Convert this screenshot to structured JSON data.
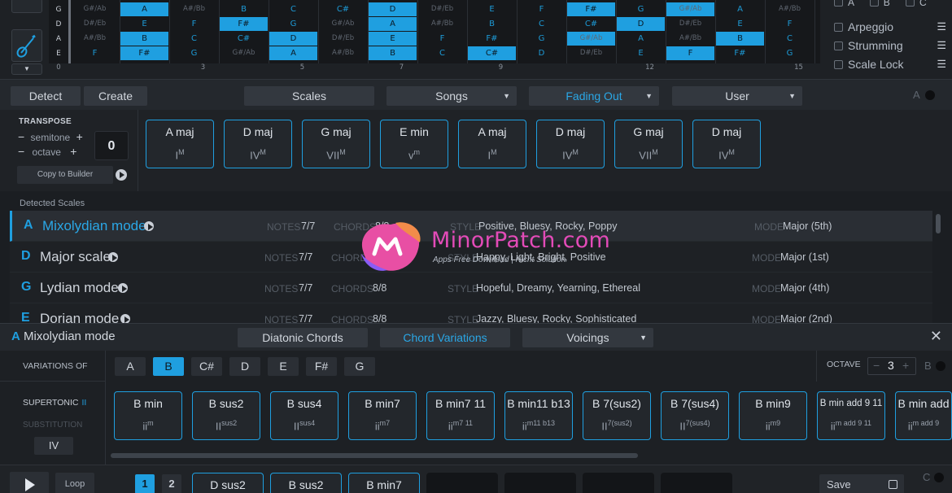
{
  "fretboard": {
    "strings": [
      "G",
      "D",
      "A",
      "E"
    ],
    "fret_numbers": [
      "0",
      "3",
      "5",
      "7",
      "9",
      "12",
      "15"
    ],
    "rows": [
      [
        "G#/Ab",
        "A",
        "A#/Bb",
        "B",
        "C",
        "C#",
        "D",
        "D#/Eb",
        "E",
        "F",
        "F#",
        "G",
        "G#/Ab",
        "A",
        "A#/Bb"
      ],
      [
        "D#/Eb",
        "E",
        "F",
        "F#",
        "G",
        "G#/Ab",
        "A",
        "A#/Bb",
        "B",
        "C",
        "C#",
        "D",
        "D#/Eb",
        "E",
        "F"
      ],
      [
        "A#/Bb",
        "B",
        "C",
        "C#",
        "D",
        "D#/Eb",
        "E",
        "F",
        "F#",
        "G",
        "G#/Ab",
        "A",
        "A#/Bb",
        "B",
        "C"
      ],
      [
        "F",
        "F#",
        "G",
        "G#/Ab",
        "A",
        "A#/Bb",
        "B",
        "C",
        "C#",
        "D",
        "D#/Eb",
        "E",
        "F",
        "F#",
        "G"
      ]
    ]
  },
  "options": {
    "top_labels": [
      "A",
      "B",
      "C"
    ],
    "items": [
      "Arpeggio",
      "Strumming",
      "Scale Lock"
    ]
  },
  "toolbar": {
    "detect": "Detect",
    "create": "Create",
    "scales": "Scales",
    "songs": "Songs",
    "fading_out": "Fading Out",
    "user": "User",
    "right_letter": "A"
  },
  "transpose": {
    "title": "TRANSPOSE",
    "semitone": "semitone",
    "octave": "octave",
    "value": "0",
    "copy_label": "Copy to Builder"
  },
  "progression": [
    {
      "name": "A maj",
      "roman": "I",
      "quality": "M"
    },
    {
      "name": "D maj",
      "roman": "IV",
      "quality": "M"
    },
    {
      "name": "G maj",
      "roman": "VII",
      "quality": "M"
    },
    {
      "name": "E min",
      "roman": "v",
      "quality": "m"
    },
    {
      "name": "A maj",
      "roman": "I",
      "quality": "M"
    },
    {
      "name": "D maj",
      "roman": "IV",
      "quality": "M"
    },
    {
      "name": "G maj",
      "roman": "VII",
      "quality": "M"
    },
    {
      "name": "D maj",
      "roman": "IV",
      "quality": "M"
    }
  ],
  "detected": {
    "title": "Detected Scales",
    "notes_label": "NOTES",
    "chords_label": "CHORDS",
    "style_label": "STYLE",
    "mode_label": "MODE",
    "rows": [
      {
        "key": "A",
        "name": "Mixolydian mode",
        "notes": "7/7",
        "chords": "8/8",
        "style": "Positive, Bluesy, Rocky, Poppy",
        "mode": "Major (5th)"
      },
      {
        "key": "D",
        "name": "Major scale",
        "notes": "7/7",
        "chords": "8/8",
        "style": "Happy, Light, Bright, Positive",
        "mode": "Major (1st)"
      },
      {
        "key": "G",
        "name": "Lydian mode",
        "notes": "7/7",
        "chords": "8/8",
        "style": "Hopeful, Dreamy, Yearning, Ethereal",
        "mode": "Major (4th)"
      },
      {
        "key": "E",
        "name": "Dorian mode",
        "notes": "7/7",
        "chords": "8/8",
        "style": "Jazzy, Bluesy, Rocky, Sophisticated",
        "mode": "Major (2nd)"
      }
    ]
  },
  "watermark": {
    "title": "MinorPatch.com",
    "subtitle": "Apps Free Download | Nicht Solution"
  },
  "panel": {
    "key": "A",
    "title": "Mixolydian mode",
    "tab_diatonic": "Diatonic Chords",
    "tab_variations": "Chord Variations",
    "tab_voicings": "Voicings"
  },
  "variations": {
    "label": "VARIATIONS OF",
    "notes": [
      "A",
      "B",
      "C#",
      "D",
      "E",
      "F#",
      "G"
    ],
    "selected": "B",
    "octave_label": "OCTAVE",
    "octave_value": "3",
    "octave_right": "B",
    "supertonic": "SUPERTONIC",
    "supertonic_roman": "II",
    "substitution": "SUBSTITUTION",
    "sub_button": "IV",
    "cards": [
      {
        "name": "B min",
        "roman": "ii",
        "quality": "m"
      },
      {
        "name": "B sus2",
        "roman": "II",
        "quality": "sus2"
      },
      {
        "name": "B sus4",
        "roman": "II",
        "quality": "sus4"
      },
      {
        "name": "B min7",
        "roman": "ii",
        "quality": "m7"
      },
      {
        "name": "B min7 11",
        "roman": "ii",
        "quality": "m7 11"
      },
      {
        "name": "B min11 b13",
        "roman": "ii",
        "quality": "m11 b13"
      },
      {
        "name": "B 7(sus2)",
        "roman": "II",
        "quality": "7(sus2)"
      },
      {
        "name": "B 7(sus4)",
        "roman": "II",
        "quality": "7(sus4)"
      },
      {
        "name": "B min9",
        "roman": "ii",
        "quality": "m9"
      },
      {
        "name": "B min add 9 11",
        "roman": "ii",
        "quality": "m add 9 11"
      },
      {
        "name": "B min add",
        "roman": "ii",
        "quality": "m add 9"
      }
    ]
  },
  "bottom": {
    "loop": "Loop",
    "pages": [
      "1",
      "2"
    ],
    "slots": [
      "D sus2",
      "B sus2",
      "B min7",
      "",
      "",
      "",
      ""
    ],
    "save": "Save",
    "right_letter": "C"
  }
}
